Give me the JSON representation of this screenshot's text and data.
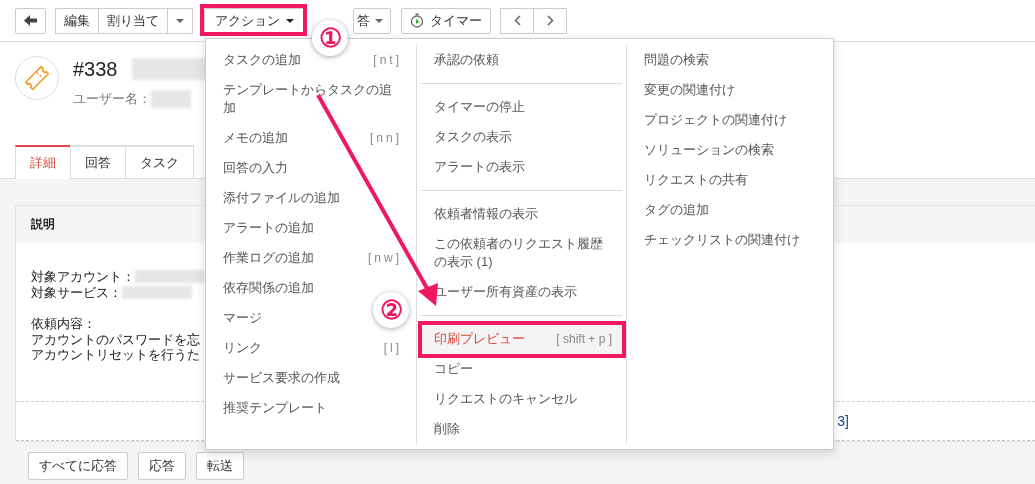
{
  "toolbar": {
    "edit": "編集",
    "assign": "割り当て",
    "action": "アクション",
    "reply_partial": "答",
    "timer": "タイマー"
  },
  "ticket": {
    "number": "#338",
    "user_label": "ユーザー名："
  },
  "tabs": [
    {
      "label": "詳細",
      "selected": true
    },
    {
      "label": "回答",
      "selected": false
    },
    {
      "label": "タスク",
      "selected": false
    }
  ],
  "description": {
    "title": "説明",
    "fields": [
      "対象アカウント：",
      "対象サービス："
    ],
    "request_lines": [
      "依頼内容：",
      "アカウントのパスワードを忘",
      "アカウントリセットを行うた"
    ],
    "link_partial": "3]"
  },
  "reply_buttons": [
    "すべてに応答",
    "応答",
    "転送"
  ],
  "menu": {
    "columns": [
      {
        "groups": [
          [
            {
              "label": "タスクの追加",
              "shortcut": "[nt]",
              "selected": false
            },
            {
              "label": "テンプレートからタスクの追加",
              "selected": false
            },
            {
              "label": "メモの追加",
              "shortcut": "[nn]",
              "selected": false
            },
            {
              "label": "回答の入力",
              "selected": false
            },
            {
              "label": "添付ファイルの追加",
              "selected": false
            },
            {
              "label": "アラートの追加",
              "selected": false
            },
            {
              "label": "作業ログの追加",
              "shortcut": "[nw]",
              "selected": false
            },
            {
              "label": "依存関係の追加",
              "selected": false
            },
            {
              "label": "マージ",
              "selected": false
            },
            {
              "label": "リンク",
              "shortcut": "[l]",
              "selected": false
            },
            {
              "label": "サービス要求の作成",
              "selected": false
            },
            {
              "label": "推奨テンプレート",
              "selected": false
            }
          ]
        ]
      },
      {
        "groups": [
          [
            {
              "label": "承認の依頼",
              "selected": false
            }
          ],
          [
            {
              "label": "タイマーの停止",
              "selected": false
            },
            {
              "label": "タスクの表示",
              "selected": false
            },
            {
              "label": "アラートの表示",
              "selected": false
            }
          ],
          [
            {
              "label": "依頼者情報の表示",
              "selected": false
            },
            {
              "label": "この依頼者のリクエスト履歴の表示 (1)",
              "selected": false
            },
            {
              "label": "ユーザー所有資産の表示",
              "selected": false
            }
          ],
          [
            {
              "label": "印刷プレビュー",
              "shortcut": "[ shift + p ]",
              "selected": true
            },
            {
              "label": "コピー",
              "selected": false
            },
            {
              "label": "リクエストのキャンセル",
              "selected": false
            },
            {
              "label": "削除",
              "selected": false
            }
          ]
        ]
      },
      {
        "groups": [
          [
            {
              "label": "問題の検索",
              "selected": false
            },
            {
              "label": "変更の関連付け",
              "selected": false
            },
            {
              "label": "プロジェクトの関連付け",
              "selected": false
            },
            {
              "label": "ソリューションの検索",
              "selected": false
            },
            {
              "label": "リクエストの共有",
              "selected": false
            },
            {
              "label": "タグの追加",
              "selected": false
            },
            {
              "label": "チェックリストの関連付け",
              "selected": false
            }
          ]
        ]
      }
    ]
  },
  "annotations": [
    {
      "label": "①"
    },
    {
      "label": "②"
    }
  ]
}
